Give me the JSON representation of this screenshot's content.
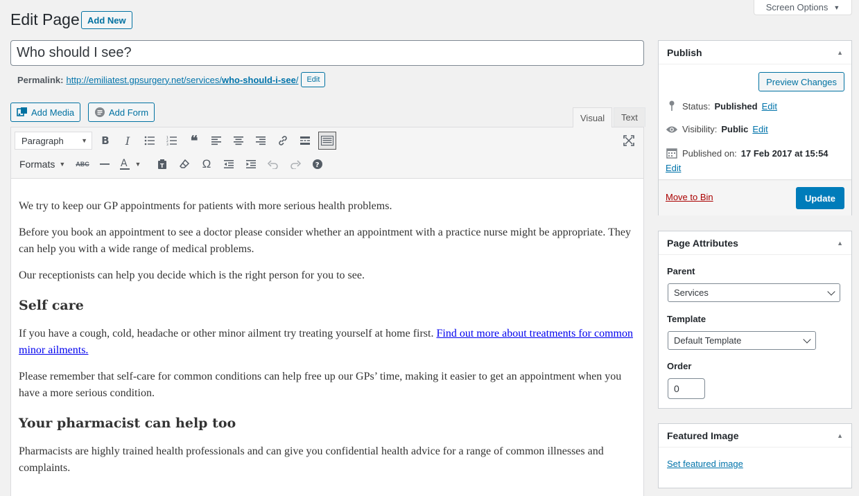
{
  "screen_options": {
    "label": "Screen Options"
  },
  "header": {
    "title": "Edit Page",
    "add_new": "Add New"
  },
  "post_title": "Who should I see?",
  "permalink": {
    "label": "Permalink:",
    "url_base": "http://emiliatest.gpsurgery.net/services/",
    "slug": "who-should-i-see",
    "trailing": "/",
    "edit": "Edit"
  },
  "media": {
    "add_media": "Add Media",
    "add_form": "Add Form"
  },
  "editor_tabs": {
    "visual": "Visual",
    "text": "Text"
  },
  "toolbar": {
    "format_select": "Paragraph",
    "formats_menu": "Formats"
  },
  "content": {
    "p1": "We try to keep our GP appointments for patients with more serious health problems.",
    "p2": "Before you book an appointment to see a doctor please consider whether an appointment with a practice nurse might be appropriate. They can help you with a wide range of medical problems.",
    "p3": "Our receptionists can help you decide which is the right person for you to see.",
    "h_self_care": "Self care",
    "p4_text": "If you have a cough, cold, headache or other minor ailment try treating yourself at home first. ",
    "p4_link": "Find out more about treatments for common minor ailments.",
    "p5": "Please remember that self-care for common conditions can help free up our GPs’ time, making it easier to get an appointment when you have a more serious condition.",
    "h_pharmacist": "Your pharmacist can help too",
    "p6": "Pharmacists are highly trained health professionals and can give you confidential health advice for a range of common illnesses and complaints."
  },
  "publish": {
    "title": "Publish",
    "preview": "Preview Changes",
    "status_label": "Status:",
    "status_value": "Published",
    "visibility_label": "Visibility:",
    "visibility_value": "Public",
    "published_label": "Published on:",
    "published_value": "17 Feb 2017 at 15:54",
    "edit": "Edit",
    "move_to_bin": "Move to Bin",
    "update": "Update"
  },
  "page_attributes": {
    "title": "Page Attributes",
    "parent_label": "Parent",
    "parent_value": "Services",
    "template_label": "Template",
    "template_value": "Default Template",
    "order_label": "Order",
    "order_value": "0"
  },
  "featured_image": {
    "title": "Featured Image",
    "set_link": "Set featured image"
  }
}
